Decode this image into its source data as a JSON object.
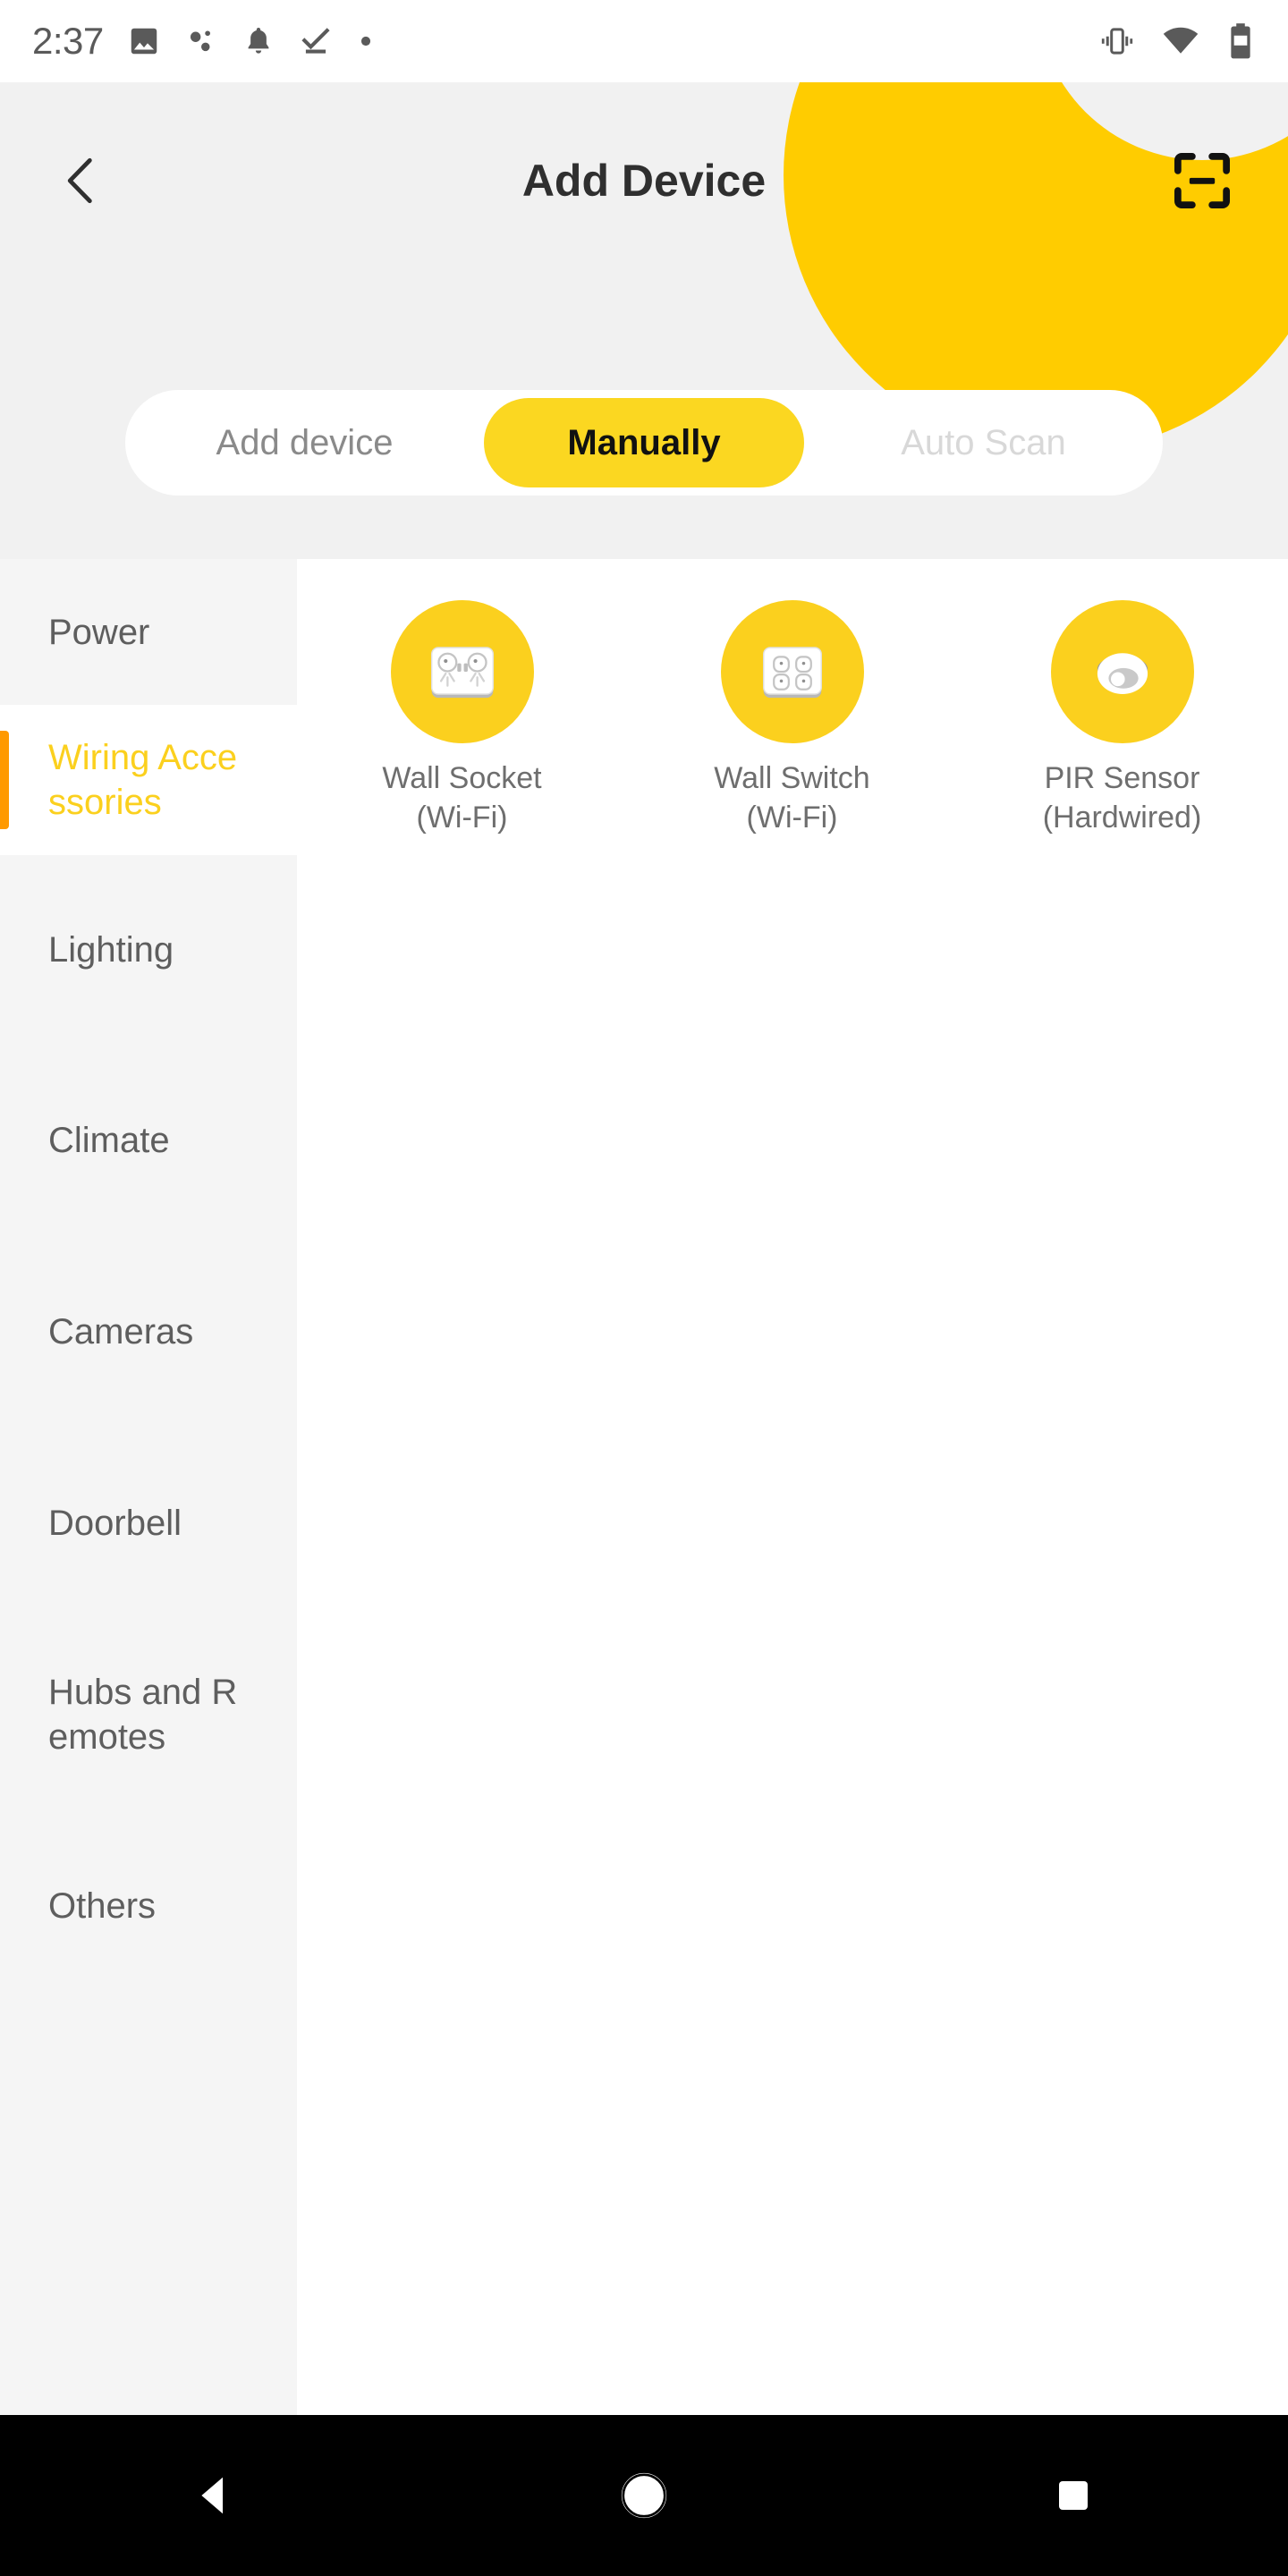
{
  "status_bar": {
    "time": "2:37",
    "left_icons": [
      "photo-icon",
      "dots-icon",
      "bell-icon",
      "check-download-icon",
      "dot-icon"
    ],
    "right_icons": [
      "vibrate-icon",
      "wifi-icon",
      "battery-icon"
    ]
  },
  "header": {
    "title": "Add Device",
    "back_icon": "chevron-left-icon",
    "scan_icon": "scan-qr-icon",
    "blob_color": "#FFCC00",
    "background": "#F1F1F1"
  },
  "tabs": {
    "items": [
      {
        "label": "Add device",
        "state": "normal"
      },
      {
        "label": "Manually",
        "state": "selected"
      },
      {
        "label": "Auto Scan",
        "state": "muted"
      }
    ],
    "selected_color": "#FBD721"
  },
  "sidebar": {
    "items": [
      {
        "label": "Power",
        "active": false
      },
      {
        "label": "Wiring Accessories",
        "active": true
      },
      {
        "label": "Lighting",
        "active": false
      },
      {
        "label": "Climate",
        "active": false
      },
      {
        "label": "Cameras",
        "active": false
      },
      {
        "label": "Doorbell",
        "active": false
      },
      {
        "label": "Hubs and Remotes",
        "active": false
      },
      {
        "label": "Others",
        "active": false
      }
    ],
    "active_color": "#FBD01E",
    "indicator_color": "#FF9900"
  },
  "devices": [
    {
      "name": "Wall Socket",
      "connectivity": "(Wi-Fi)",
      "icon": "wall-socket-icon"
    },
    {
      "name": "Wall Switch",
      "connectivity": "(Wi-Fi)",
      "icon": "wall-switch-icon"
    },
    {
      "name": "PIR Sensor",
      "connectivity": "(Hardwired)",
      "icon": "pir-sensor-icon"
    }
  ],
  "navbar": {
    "back": "nav-back-icon",
    "home": "nav-home-icon",
    "recents": "nav-recents-icon"
  }
}
